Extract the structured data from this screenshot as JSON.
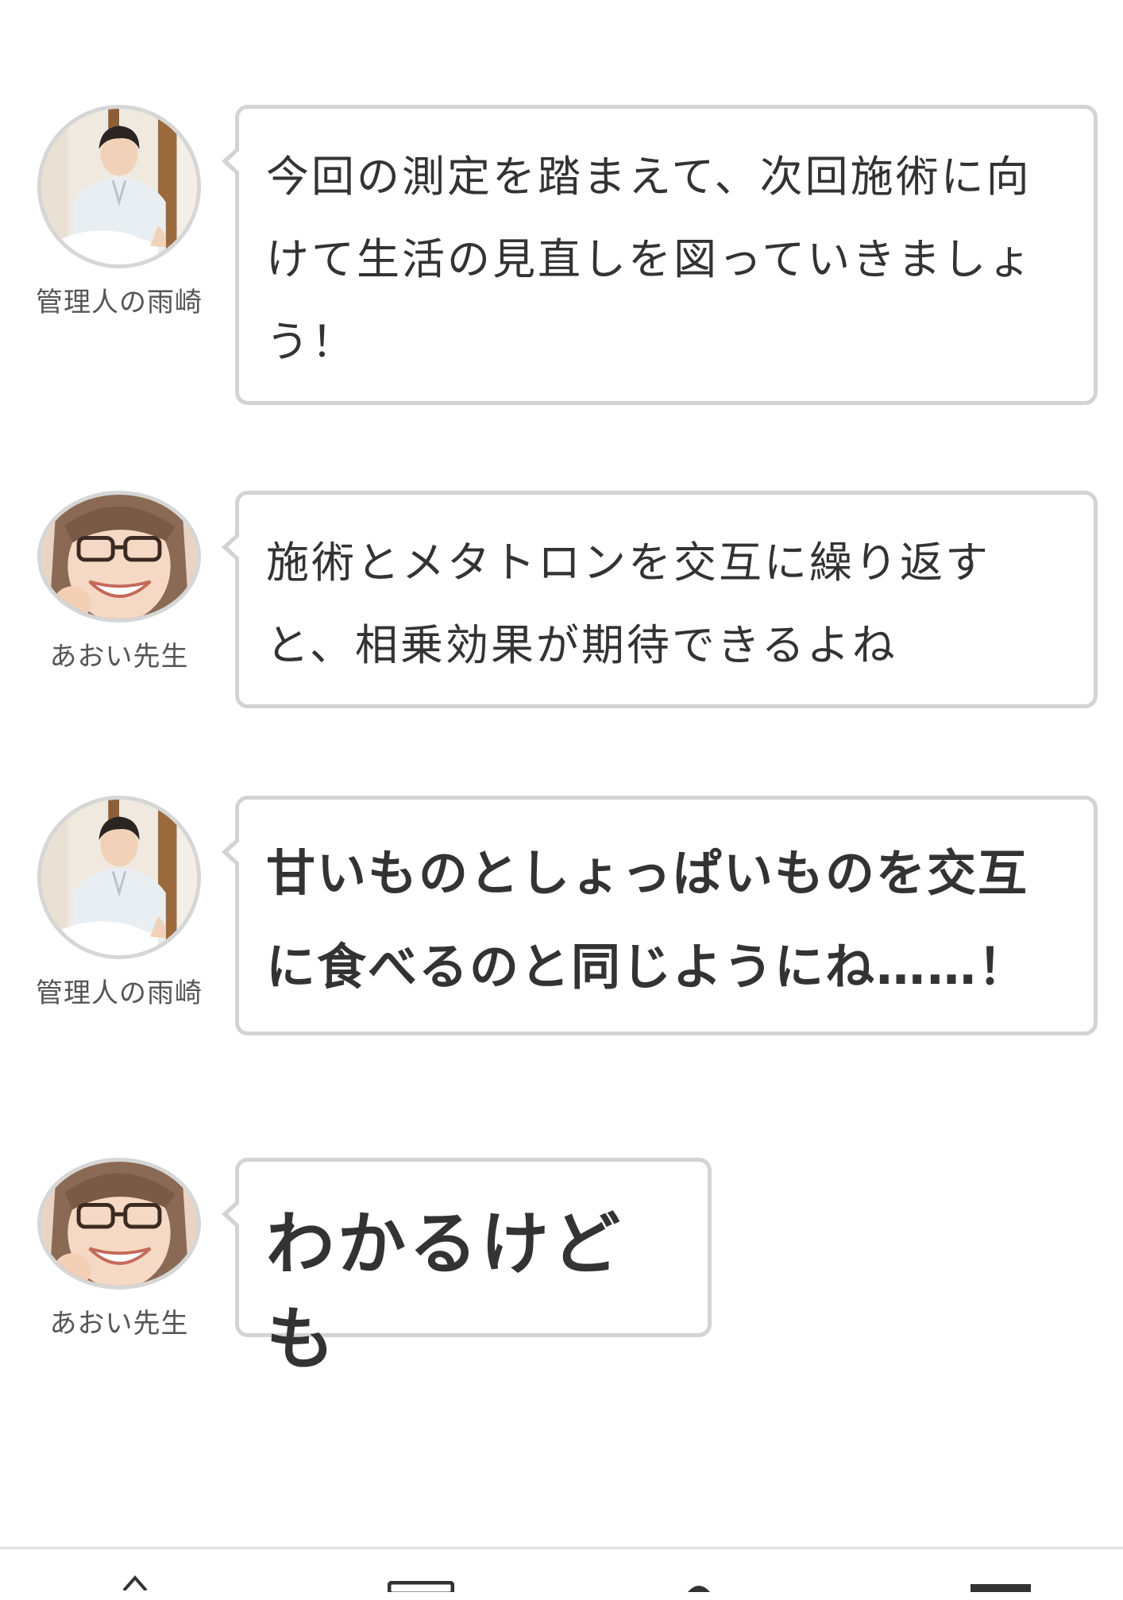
{
  "messages": [
    {
      "speaker": {
        "name": "管理人の雨崎",
        "avatar": "male-therapist-photo"
      },
      "text": "今回の測定を踏まえて、次回施術に向けて生活の見直しを図っていきましょう！",
      "style": "normal"
    },
    {
      "speaker": {
        "name": "あおい先生",
        "avatar": "smiling-woman-photo"
      },
      "text": "施術とメタトロンを交互に繰り返すと、相乗効果が期待できるよね",
      "style": "normal"
    },
    {
      "speaker": {
        "name": "管理人の雨崎",
        "avatar": "male-therapist-photo"
      },
      "text": "甘いものとしょっぱいものを交互に食べるのと同じようにね……！",
      "style": "bold"
    },
    {
      "speaker": {
        "name": "あおい先生",
        "avatar": "smiling-woman-photo"
      },
      "text": "わかるけども",
      "style": "big"
    }
  ],
  "bottom_nav": {
    "icons": [
      "home-icon",
      "calendar-icon",
      "person-icon",
      "menu-icon"
    ]
  },
  "colors": {
    "bubble_border": "#d3d3d3",
    "avatar_border": "#d6d6d6",
    "text": "#333333",
    "name_text": "#555555"
  }
}
